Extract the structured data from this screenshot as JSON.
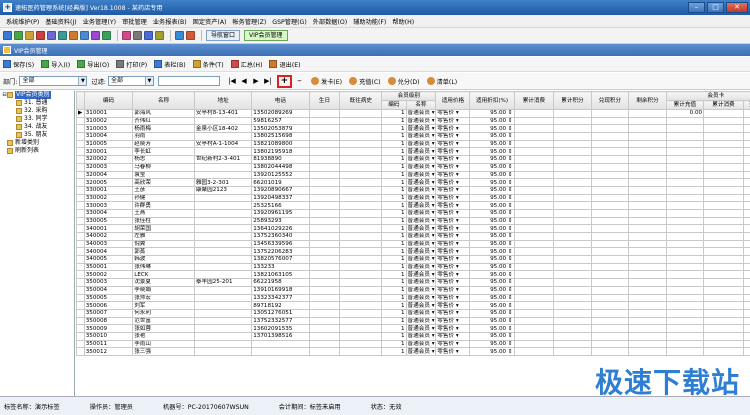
{
  "window": {
    "title": "速拓医药管理系统[经典版] Ver18.1008 - 某药店专用",
    "min": "–",
    "max": "□",
    "close": "✕"
  },
  "menu": [
    "系统维护(P)",
    "基础资料(J)",
    "业务管理(Y)",
    "审批管理",
    "业务报表(B)",
    "固定资产(A)",
    "帐务管理(Z)",
    "GSP管理(G)",
    "外部数据(O)",
    "辅助功能(F)",
    "帮助(H)"
  ],
  "toolbar_icons": [
    "#3a7bd5",
    "#4aa64a",
    "#d0a030",
    "#c84040",
    "#6a6ad0",
    "#3a9a9a",
    "#d07a30",
    "#4a8ad5",
    "#9a4ad0",
    "#3aa060",
    "#d04a8a",
    "#7a7a7a",
    "#4a6ad5",
    "#a0a030",
    "#3a8ad5",
    "#d05a3a"
  ],
  "nav_buttons": [
    "导航窗口",
    "VIP会员管理"
  ],
  "vip_window_title": "VIP会员管理",
  "toolbar2": [
    "保存(S)",
    "导入(I)",
    "导出(O)",
    "打印(P)",
    "表栏(B)",
    "条件(T)",
    "汇总(H)",
    "退出(E)"
  ],
  "filter": {
    "dept_label": "部门:",
    "dept_value": "全部",
    "filter_label": "过滤:",
    "filter_value": "全部"
  },
  "pager": [
    "|◀",
    "◀",
    "▶",
    "▶|"
  ],
  "plus": "+",
  "minus": "–",
  "actions": [
    "发卡(E)",
    "充值(C)",
    "兑分(D)",
    "清单(L)"
  ],
  "tree": [
    {
      "label": "VIP会员类别",
      "selected": true,
      "indent": 0,
      "twisty": "⊟"
    },
    {
      "label": "31. 普通",
      "indent": 1,
      "twisty": ""
    },
    {
      "label": "32. 采购",
      "indent": 1,
      "twisty": ""
    },
    {
      "label": "33. 同学",
      "indent": 1,
      "twisty": ""
    },
    {
      "label": "34. 战友",
      "indent": 1,
      "twisty": ""
    },
    {
      "label": "35. 朋友",
      "indent": 1,
      "twisty": ""
    },
    {
      "label": "新增类别",
      "indent": 0,
      "twisty": ""
    },
    {
      "label": "刷新列表",
      "indent": 0,
      "twisty": ""
    }
  ],
  "grid": {
    "group_headers": {
      "level": "会员级别",
      "card": "会员卡"
    },
    "headers": [
      "编码",
      "名称",
      "地址",
      "电话",
      "生日",
      "既往病史",
      "编码",
      "名称",
      "适用价格",
      "适用折扣(%)",
      "累计消费",
      "累计积分",
      "兑现积分",
      "剩余积分",
      "累计充值",
      "累计消费",
      "当前"
    ],
    "level_code": "1",
    "level_name": "普通会员",
    "price": "零售价",
    "discount": "95.00",
    "first_row_recharge": "0.00",
    "rows": [
      [
        "310001",
        "郭海风",
        "安亭村8-13-401",
        "13502089269"
      ],
      [
        "310002",
        "齐伟红",
        "",
        "59816257"
      ],
      [
        "310003",
        "杨雨梅",
        "金泉小区18-402",
        "13502053879"
      ],
      [
        "310004",
        "羽雨",
        "",
        "13802515698"
      ],
      [
        "310005",
        "赵晓芳",
        "安亭村A-1-1004",
        "13821089800"
      ],
      [
        "320001",
        "李长虹",
        "",
        "13802195918"
      ],
      [
        "320002",
        "杨志",
        "世纪新村2-3-401",
        "81938890"
      ],
      [
        "320003",
        "马春柳",
        "",
        "13802044498"
      ],
      [
        "320004",
        "袁莹",
        "",
        "13920125552"
      ],
      [
        "320005",
        "高欣荣",
        "雅园3-2-301",
        "66201019"
      ],
      [
        "330001",
        "王彦",
        "康聚园2123",
        "13920890667"
      ],
      [
        "330002",
        "孙健",
        "",
        "13920498337"
      ],
      [
        "330003",
        "许群勇",
        "",
        "25325166"
      ],
      [
        "330004",
        "王燕",
        "",
        "13920961195"
      ],
      [
        "330005",
        "张佳柱",
        "",
        "25893293"
      ],
      [
        "340001",
        "胡荣国",
        "",
        "13641029226"
      ],
      [
        "340002",
        "左雅",
        "",
        "13752360340"
      ],
      [
        "340003",
        "倪翼",
        "",
        "13456339596"
      ],
      [
        "340004",
        "郭蒸",
        "",
        "13752206283"
      ],
      [
        "340005",
        "韩波",
        "",
        "13820576007"
      ],
      [
        "350001",
        "张伟琳",
        "",
        "133233"
      ],
      [
        "350002",
        "LECK",
        "",
        "13821063105"
      ],
      [
        "350003",
        "沈景夏",
        "泰丰园25-201",
        "66221958"
      ],
      [
        "350004",
        "李晓娟",
        "",
        "13910169918"
      ],
      [
        "350005",
        "张师宏",
        "",
        "13323342377"
      ],
      [
        "350006",
        "刘军",
        "",
        "89718192"
      ],
      [
        "350007",
        "何永利",
        "",
        "13051276051"
      ],
      [
        "350008",
        "范世富",
        "",
        "13752332577"
      ],
      [
        "350009",
        "张如蓉",
        "",
        "13602091535"
      ],
      [
        "350010",
        "张艳",
        "",
        "13701398516"
      ],
      [
        "350011",
        "李雨山",
        "",
        ""
      ],
      [
        "350012",
        "张三强",
        "",
        ""
      ]
    ]
  },
  "status": [
    "标签名称：演示标签",
    "操作员：管理员",
    "机器号：PC-20170607WSUN",
    "会计期间：标签未启用",
    "状态：无效"
  ],
  "watermark": "极速下载站"
}
